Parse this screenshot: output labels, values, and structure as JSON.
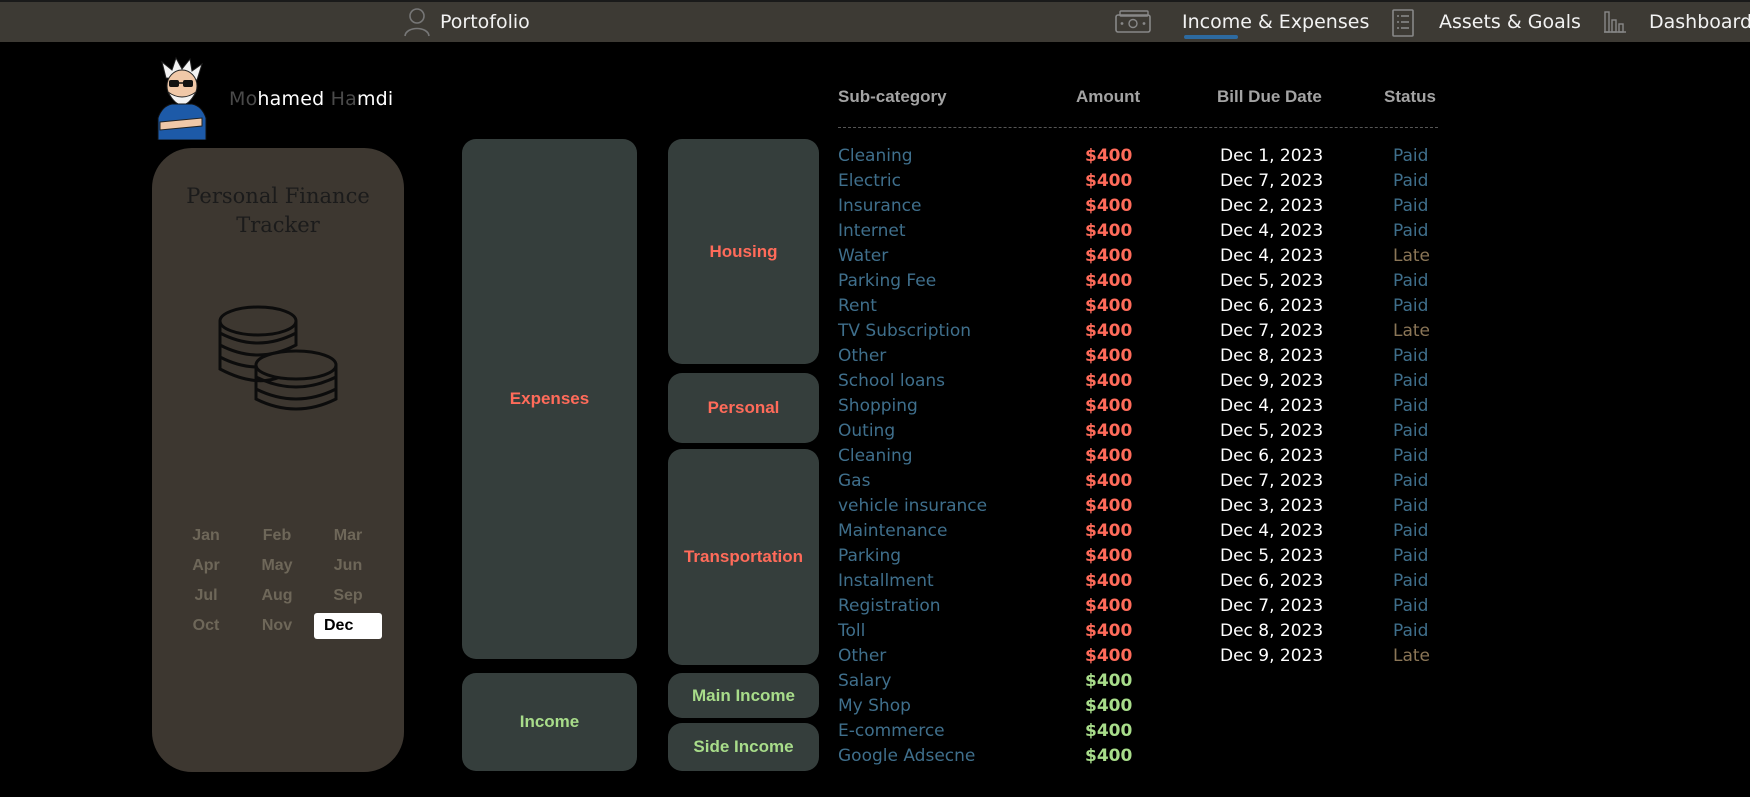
{
  "nav": {
    "portfolio": "Portofolio",
    "income_expenses": "Income & Expenses",
    "assets_goals": "Assets & Goals",
    "dashboard": "Dashboard"
  },
  "user": {
    "name_prefix": "Mo",
    "name_a": "hamed ",
    "name_b": "Ha",
    "name_c": "mdi"
  },
  "tracker": {
    "title_line1": "Personal Finance",
    "title_line2": "Tracker"
  },
  "months": [
    "Jan",
    "Feb",
    "Mar",
    "Apr",
    "May",
    "Jun",
    "Jul",
    "Aug",
    "Sep",
    "Oct",
    "Nov",
    "Dec"
  ],
  "selected_month": "Dec",
  "categories": {
    "expenses": "Expenses",
    "income": "Income",
    "housing": "Housing",
    "personal": "Personal",
    "transportation": "Transportation",
    "main_income": "Main Income",
    "side_income": "Side Income"
  },
  "table": {
    "headers": {
      "sub": "Sub-category",
      "amount": "Amount",
      "due": "Bill Due Date",
      "status": "Status"
    },
    "rows": [
      {
        "sub": "Cleaning",
        "amount": "$400",
        "due": "Dec 1, 2023",
        "status": "Paid",
        "type": "expense"
      },
      {
        "sub": "Electric",
        "amount": "$400",
        "due": "Dec 7, 2023",
        "status": "Paid",
        "type": "expense"
      },
      {
        "sub": "Insurance",
        "amount": "$400",
        "due": "Dec 2, 2023",
        "status": "Paid",
        "type": "expense"
      },
      {
        "sub": "Internet",
        "amount": "$400",
        "due": "Dec 4, 2023",
        "status": "Paid",
        "type": "expense"
      },
      {
        "sub": "Water",
        "amount": "$400",
        "due": "Dec 4, 2023",
        "status": "Late",
        "type": "expense"
      },
      {
        "sub": "Parking Fee",
        "amount": "$400",
        "due": "Dec 5, 2023",
        "status": "Paid",
        "type": "expense"
      },
      {
        "sub": "Rent",
        "amount": "$400",
        "due": "Dec 6, 2023",
        "status": "Paid",
        "type": "expense"
      },
      {
        "sub": "TV Subscription",
        "amount": "$400",
        "due": "Dec 7, 2023",
        "status": "Late",
        "type": "expense"
      },
      {
        "sub": "Other",
        "amount": "$400",
        "due": "Dec 8, 2023",
        "status": "Paid",
        "type": "expense"
      },
      {
        "sub": "School loans",
        "amount": "$400",
        "due": "Dec 9, 2023",
        "status": "Paid",
        "type": "expense"
      },
      {
        "sub": "Shopping",
        "amount": "$400",
        "due": "Dec 4, 2023",
        "status": "Paid",
        "type": "expense"
      },
      {
        "sub": "Outing",
        "amount": "$400",
        "due": "Dec 5, 2023",
        "status": "Paid",
        "type": "expense"
      },
      {
        "sub": "Cleaning",
        "amount": "$400",
        "due": "Dec 6, 2023",
        "status": "Paid",
        "type": "expense"
      },
      {
        "sub": "Gas",
        "amount": "$400",
        "due": "Dec 7, 2023",
        "status": "Paid",
        "type": "expense"
      },
      {
        "sub": "vehicle insurance",
        "amount": "$400",
        "due": "Dec 3, 2023",
        "status": "Paid",
        "type": "expense"
      },
      {
        "sub": "Maintenance",
        "amount": "$400",
        "due": "Dec 4, 2023",
        "status": "Paid",
        "type": "expense"
      },
      {
        "sub": "Parking",
        "amount": "$400",
        "due": "Dec 5, 2023",
        "status": "Paid",
        "type": "expense"
      },
      {
        "sub": "Installment",
        "amount": "$400",
        "due": "Dec 6, 2023",
        "status": "Paid",
        "type": "expense"
      },
      {
        "sub": "Registration",
        "amount": "$400",
        "due": "Dec 7, 2023",
        "status": "Paid",
        "type": "expense"
      },
      {
        "sub": "Toll",
        "amount": "$400",
        "due": "Dec 8, 2023",
        "status": "Paid",
        "type": "expense"
      },
      {
        "sub": "Other",
        "amount": "$400",
        "due": "Dec 9, 2023",
        "status": "Late",
        "type": "expense"
      },
      {
        "sub": "Salary",
        "amount": "$400",
        "due": "",
        "status": "",
        "type": "income"
      },
      {
        "sub": "My Shop",
        "amount": "$400",
        "due": "",
        "status": "",
        "type": "income"
      },
      {
        "sub": "E-commerce",
        "amount": "$400",
        "due": "",
        "status": "",
        "type": "income"
      },
      {
        "sub": "Google Adsecne",
        "amount": "$400",
        "due": "",
        "status": "",
        "type": "income"
      }
    ]
  },
  "colors": {
    "expense_amount": "#ff6b5a",
    "income_amount": "#a8dc8a",
    "status_paid": "#3f6f8c",
    "status_late": "#8b7657",
    "nav_bg": "#3d3a34",
    "card_bg": "#3d3730",
    "block_bg": "#353e3c"
  }
}
